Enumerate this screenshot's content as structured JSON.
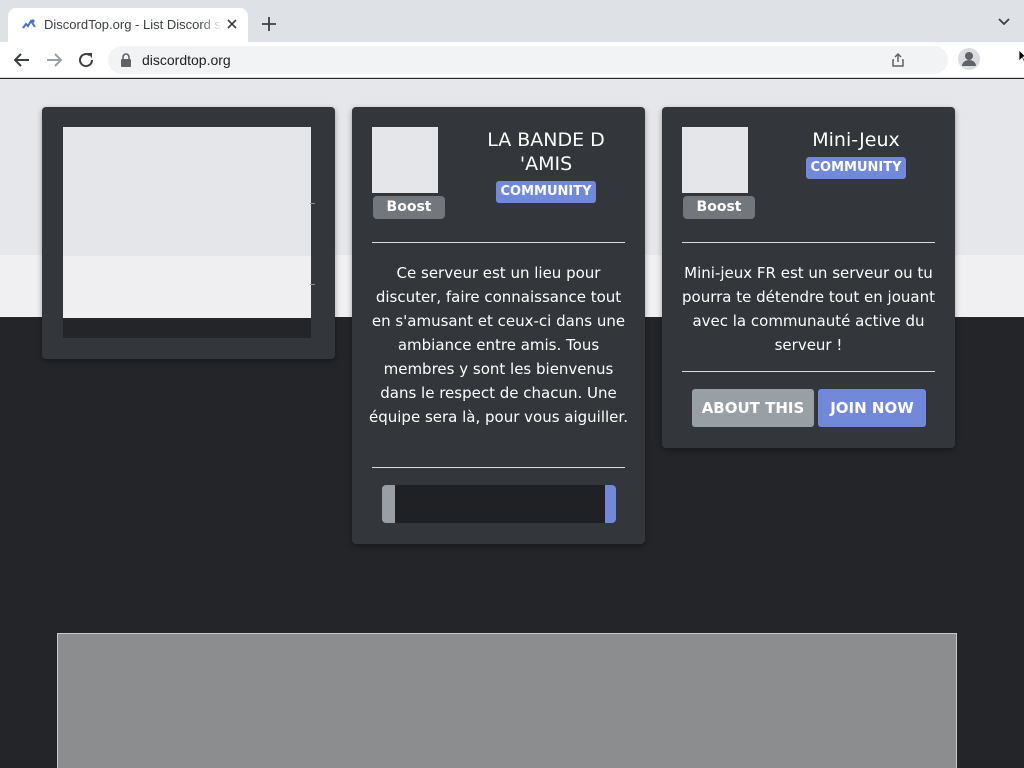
{
  "browser": {
    "tab_title": "DiscordTop.org - List Discord servers",
    "url": "discordtop.org"
  },
  "cards": [
    {},
    {
      "name": "LA BANDE D 'AMIS",
      "boost_label": "Boost",
      "badge_label": "COMMUNITY",
      "description": "Ce serveur est un lieu pour discuter, faire connaissance tout en s'amusant et ceux-ci dans une ambiance entre amis. Tous membres y sont les bienvenus dans le respect de chacun. Une équipe sera là, pour vous aiguiller."
    },
    {
      "name": "Mini-Jeux",
      "boost_label": "Boost",
      "badge_label": "COMMUNITY",
      "description": "Mini-jeux FR est un serveur ou tu pourra te détendre tout en jouant avec la communauté active du serveur !",
      "about_label": "ABOUT THIS",
      "join_label": "JOIN NOW"
    }
  ],
  "colors": {
    "accent": "#7289da",
    "card_bg": "#33363b",
    "page_bg": "#232528",
    "boost_bg": "#72767d",
    "about_bg": "#99a0a5"
  }
}
